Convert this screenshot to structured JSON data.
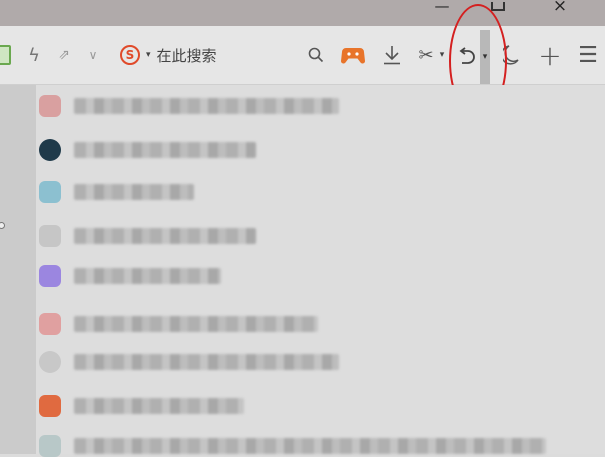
{
  "window": {
    "minimize_icon": "minimize-icon",
    "restore_icon": "restore-icon",
    "close_glyph": "×"
  },
  "toolbar": {
    "search_logo": "S",
    "search_caret": "▾",
    "search_placeholder": "在此搜索",
    "dropdown_glyph": "∨",
    "undo_caret": "▾",
    "cut_caret": "▾"
  },
  "icons": {
    "reading": "book-icon",
    "bolt": "lightning-icon",
    "share": "share-icon",
    "search": "magnifier-icon",
    "game": "gamepad-icon",
    "download": "download-icon",
    "cut": "scissors-icon",
    "undo": "undo-icon",
    "night": "moon-icon",
    "new_tab": "plus-icon",
    "menu": "hamburger-menu-icon"
  },
  "colors": {
    "annotation_circle": "#d42020",
    "search_brand": "#e04a2a",
    "game_icon": "#e8742a"
  },
  "list_items": [
    {
      "icon_color": "#d9a0a0"
    },
    {
      "icon_color": "#1f3a4a"
    },
    {
      "icon_color": "#8cc0d0"
    },
    {
      "icon_color": "#c6c6c6"
    },
    {
      "icon_color": "#9b86e0"
    },
    {
      "icon_color": "#e0a0a0"
    },
    {
      "icon_color": "#c8c8c8"
    },
    {
      "icon_color": "#e06a40"
    },
    {
      "icon_color": "#b8c8c8"
    }
  ]
}
